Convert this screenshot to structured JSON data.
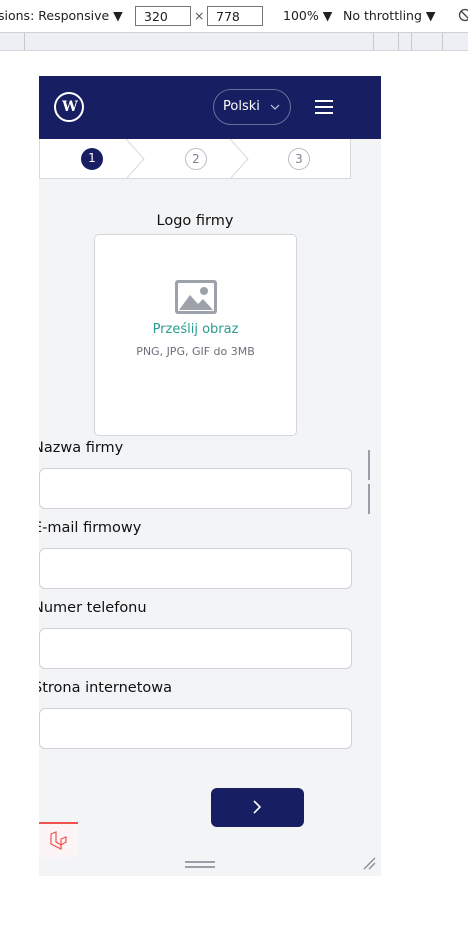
{
  "devtools": {
    "dimensions_label": "sions: Responsive",
    "width": "320",
    "times": "×",
    "height": "778",
    "zoom": "100%",
    "throttling": "No throttling"
  },
  "header": {
    "logo_text": "W",
    "language": "Polski"
  },
  "stepper": {
    "steps": [
      "1",
      "2",
      "3"
    ],
    "active_step": "1"
  },
  "logo_upload": {
    "title": "Logo firmy",
    "link": "Prześlij obraz",
    "hint": "PNG, JPG, GIF do 3MB"
  },
  "fields": {
    "company_name": {
      "label": "Nazwa firmy",
      "value": ""
    },
    "company_email": {
      "label": "E-mail firmowy",
      "value": ""
    },
    "phone": {
      "label": "Numer telefonu",
      "value": ""
    },
    "website": {
      "label": "Strona internetowa",
      "value": ""
    }
  },
  "colors": {
    "brand": "#171e62",
    "accent": "#2a9d8f",
    "background": "#f3f4f6"
  }
}
